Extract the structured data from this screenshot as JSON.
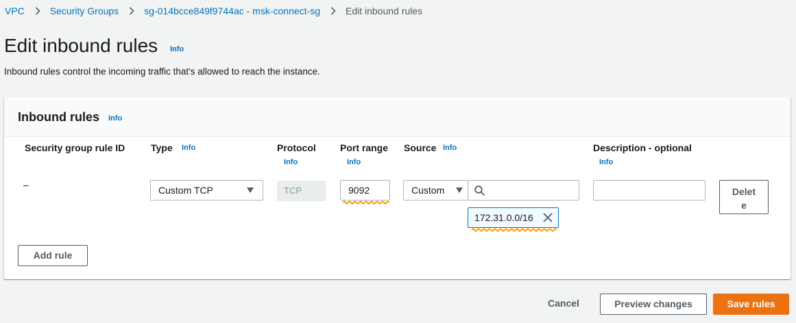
{
  "breadcrumb": {
    "items": [
      "VPC",
      "Security Groups",
      "sg-014bcce849f9744ac - msk-connect-sg"
    ],
    "current": "Edit inbound rules"
  },
  "header": {
    "title": "Edit inbound rules",
    "info": "Info",
    "description": "Inbound rules control the incoming traffic that's allowed to reach the instance."
  },
  "panel": {
    "title": "Inbound rules",
    "info": "Info",
    "columns": {
      "rule_id": "Security group rule ID",
      "type": "Type",
      "protocol": "Protocol",
      "port_range": "Port range",
      "source": "Source",
      "description": "Description - optional",
      "info": "Info"
    },
    "row": {
      "rule_id": "–",
      "type": "Custom TCP",
      "protocol": "TCP",
      "port_range": "9092",
      "source_type": "Custom",
      "source_search": "",
      "source_token": "172.31.0.0/16",
      "description": "",
      "delete_label": "Delete"
    },
    "add_rule_label": "Add rule"
  },
  "footer": {
    "cancel_label": "Cancel",
    "preview_label": "Preview changes",
    "save_label": "Save rules"
  },
  "colors": {
    "link": "#0073bb",
    "primary": "#ec7211",
    "squiggle": "#ff9900"
  }
}
